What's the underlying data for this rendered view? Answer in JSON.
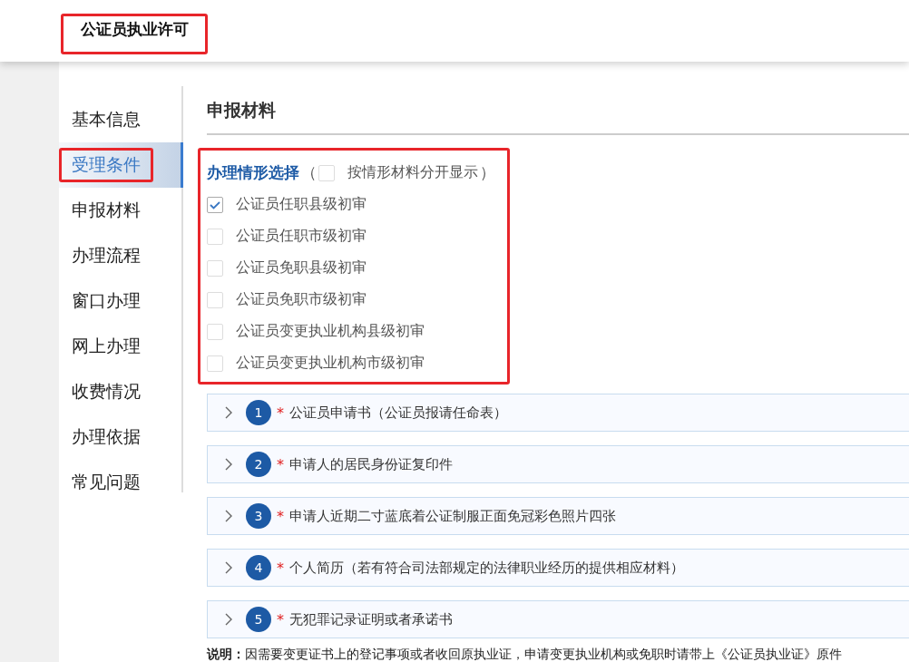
{
  "header": {
    "title": "公证员执业许可",
    "highlighted": true
  },
  "sidebar": {
    "items": [
      {
        "label": "基本信息",
        "selected": false,
        "highlighted": false
      },
      {
        "label": "受理条件",
        "selected": true,
        "highlighted": true
      },
      {
        "label": "申报材料",
        "selected": false,
        "highlighted": false
      },
      {
        "label": "办理流程",
        "selected": false,
        "highlighted": false
      },
      {
        "label": "窗口办理",
        "selected": false,
        "highlighted": false
      },
      {
        "label": "网上办理",
        "selected": false,
        "highlighted": false
      },
      {
        "label": "收费情况",
        "selected": false,
        "highlighted": false
      },
      {
        "label": "办理依据",
        "selected": false,
        "highlighted": false
      },
      {
        "label": "常见问题",
        "selected": false,
        "highlighted": false
      }
    ]
  },
  "section_title": "申报材料",
  "situation": {
    "highlighted": true,
    "label": "办理情形选择",
    "paren_open": "（",
    "paren_close": "）",
    "separate_display": {
      "label": "按情形材料分开显示",
      "checked": false
    },
    "options": [
      {
        "label": "公证员任职县级初审",
        "checked": true
      },
      {
        "label": "公证员任职市级初审",
        "checked": false
      },
      {
        "label": "公证员免职县级初审",
        "checked": false
      },
      {
        "label": "公证员免职市级初审",
        "checked": false
      },
      {
        "label": "公证员变更执业机构县级初审",
        "checked": false
      },
      {
        "label": "公证员变更执业机构市级初审",
        "checked": false
      }
    ]
  },
  "materials": [
    {
      "number": "1",
      "required": true,
      "required_mark": "*",
      "title": "公证员申请书（公证员报请任命表）"
    },
    {
      "number": "2",
      "required": true,
      "required_mark": "*",
      "title": "申请人的居民身份证复印件"
    },
    {
      "number": "3",
      "required": true,
      "required_mark": "*",
      "title": "申请人近期二寸蓝底着公证制服正面免冠彩色照片四张"
    },
    {
      "number": "4",
      "required": true,
      "required_mark": "*",
      "title": "个人简历（若有符合司法部规定的法律职业经历的提供相应材料）"
    },
    {
      "number": "5",
      "required": true,
      "required_mark": "*",
      "title": "无犯罪记录证明或者承诺书"
    }
  ],
  "note": {
    "label": "说明：",
    "text": "因需要变更证书上的登记事项或者收回原执业证，申请变更执业机构或免职时请带上《公证员执业证》原件"
  }
}
